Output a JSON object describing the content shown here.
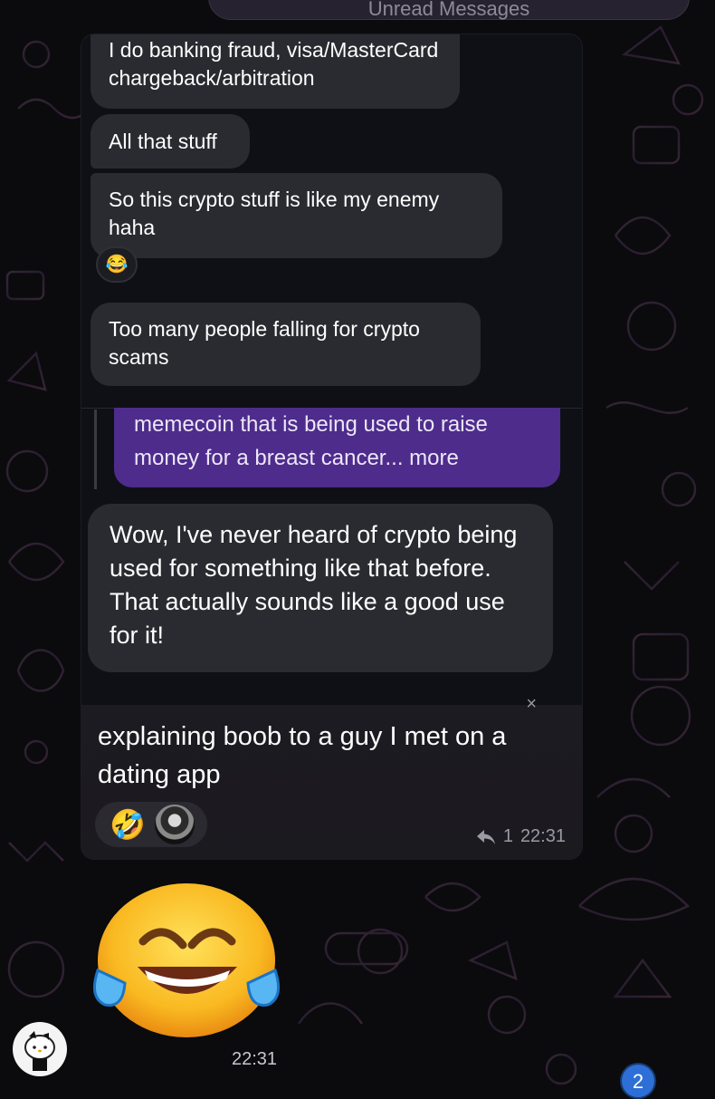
{
  "topbar": {
    "label": "Unread Messages"
  },
  "embedded_screenshot": {
    "messages": [
      {
        "text": "I do banking fraud, visa/MasterCard chargeback/arbitration"
      },
      {
        "text": "All that stuff"
      },
      {
        "text": "So this crypto stuff is like my enemy haha"
      },
      {
        "text": "Too many people falling for crypto scams"
      }
    ],
    "reaction_emoji": "😂",
    "reply_quote": {
      "line1": "memecoin that is being used to raise",
      "line2": "money for a breast cancer... ",
      "more": "more"
    },
    "reply": "Wow, I've never heard of crypto being used for something like that before. That actually sounds like a good use for it!"
  },
  "caption": {
    "text": "explaining boob to a guy I met on a dating app",
    "reaction_emoji": "🤣",
    "reply_count": "1",
    "time": "22:31"
  },
  "sticker": {
    "emoji": "joy-face-emoji",
    "time": "22:31"
  },
  "unread_badge": "2",
  "colors": {
    "background": "#0b0a0d",
    "incoming_bubble": "#2a2b31",
    "outgoing_bubble": "#4e2c8c",
    "badge": "#2d6fd6"
  }
}
